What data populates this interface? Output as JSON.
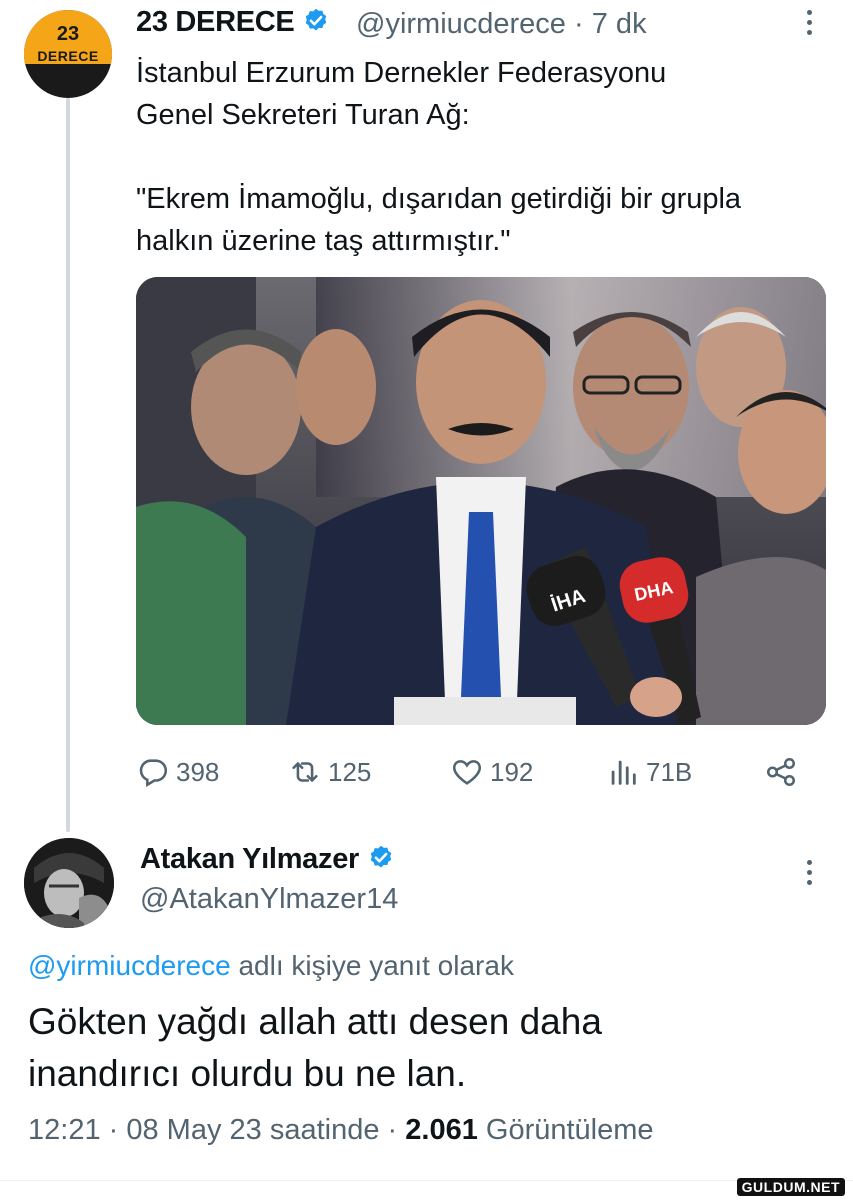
{
  "tweet": {
    "avatar_text_number": "23",
    "avatar_text_word": "DERECE",
    "display_name": "23 DERECE",
    "handle": "@yirmiucderece",
    "separator": "·",
    "time_ago": "7 dk",
    "text": "İstanbul Erzurum Dernekler Federasyonu\nGenel Sekreteri Turan Ağ:\n\n\"Ekrem İmamoğlu, dışarıdan getirdiği bir grupla\nhalkın üzerine taş attırmıştır.\"",
    "photo": {
      "microphone_left_label": "İHA",
      "microphone_right_label": "DHA"
    },
    "actions": {
      "replies": "398",
      "retweets": "125",
      "likes": "192",
      "views": "71B"
    }
  },
  "reply": {
    "display_name": "Atakan Yılmazer",
    "handle": "@AtakanYlmazer14",
    "replying_to_mention": "@yirmiucderece",
    "replying_to_suffix": " adlı kişiye yanıt olarak",
    "text": "Gökten yağdı allah attı desen daha\ninandırıcı olurdu bu ne lan.",
    "time": "12:21",
    "separator": " · ",
    "date": "08 May 23 saatinde",
    "separator2": " · ",
    "views_count": "2.061",
    "views_label": " Görüntüleme"
  },
  "watermark": "GULDUM.NET",
  "colors": {
    "accent": "#1d9bf0",
    "secondary_text": "#536471",
    "primary_text": "#0f1419",
    "brand_yellow": "#f4a518"
  },
  "icons": {
    "verified": "verified-badge-icon",
    "more": "more-options-icon",
    "reply": "reply-icon",
    "retweet": "retweet-icon",
    "like": "heart-icon",
    "views": "views-chart-icon",
    "share": "share-icon"
  }
}
